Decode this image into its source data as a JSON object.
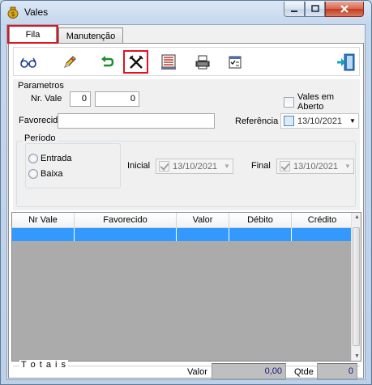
{
  "window": {
    "title": "Vales"
  },
  "tabs": [
    {
      "label": "Fila"
    },
    {
      "label": "Manutenção"
    }
  ],
  "toolbar": {
    "buttons": [
      {
        "icon": "search-glasses-icon"
      },
      {
        "icon": "edit-pencil-icon"
      },
      {
        "icon": "undo-arrow-icon"
      },
      {
        "icon": "cancel-x-icon"
      },
      {
        "icon": "report-list-icon"
      },
      {
        "icon": "printer-icon"
      },
      {
        "icon": "checklist-icon"
      },
      {
        "icon": "exit-door-icon"
      }
    ]
  },
  "params": {
    "group_label": "Parametros",
    "nr_vale_label": "Nr. Vale",
    "nr_vale_from": "0",
    "nr_vale_to": "0",
    "vales_em_aberto_label": "Vales em Aberto",
    "favorecido_label": "Favorecido",
    "favorecido_value": "",
    "referencia_label": "Referência",
    "referencia_date": "13/10/2021"
  },
  "periodo": {
    "label": "Período",
    "options": [
      {
        "label": "Entrada"
      },
      {
        "label": "Baixa"
      }
    ],
    "inicial_label": "Inicial",
    "inicial_date": "13/10/2021",
    "final_label": "Final",
    "final_date": "13/10/2021"
  },
  "grid": {
    "columns": [
      "Nr Vale",
      "Favorecido",
      "Valor",
      "Débito",
      "Crédito"
    ]
  },
  "totals": {
    "label": "T o t a i s",
    "valor_label": "Valor",
    "valor": "0,00",
    "qtde_label": "Qtde",
    "qtde": "0"
  },
  "colors": {
    "selection": "#3399ff",
    "highlight": "#e0141e",
    "grid_bg": "#ababab"
  }
}
